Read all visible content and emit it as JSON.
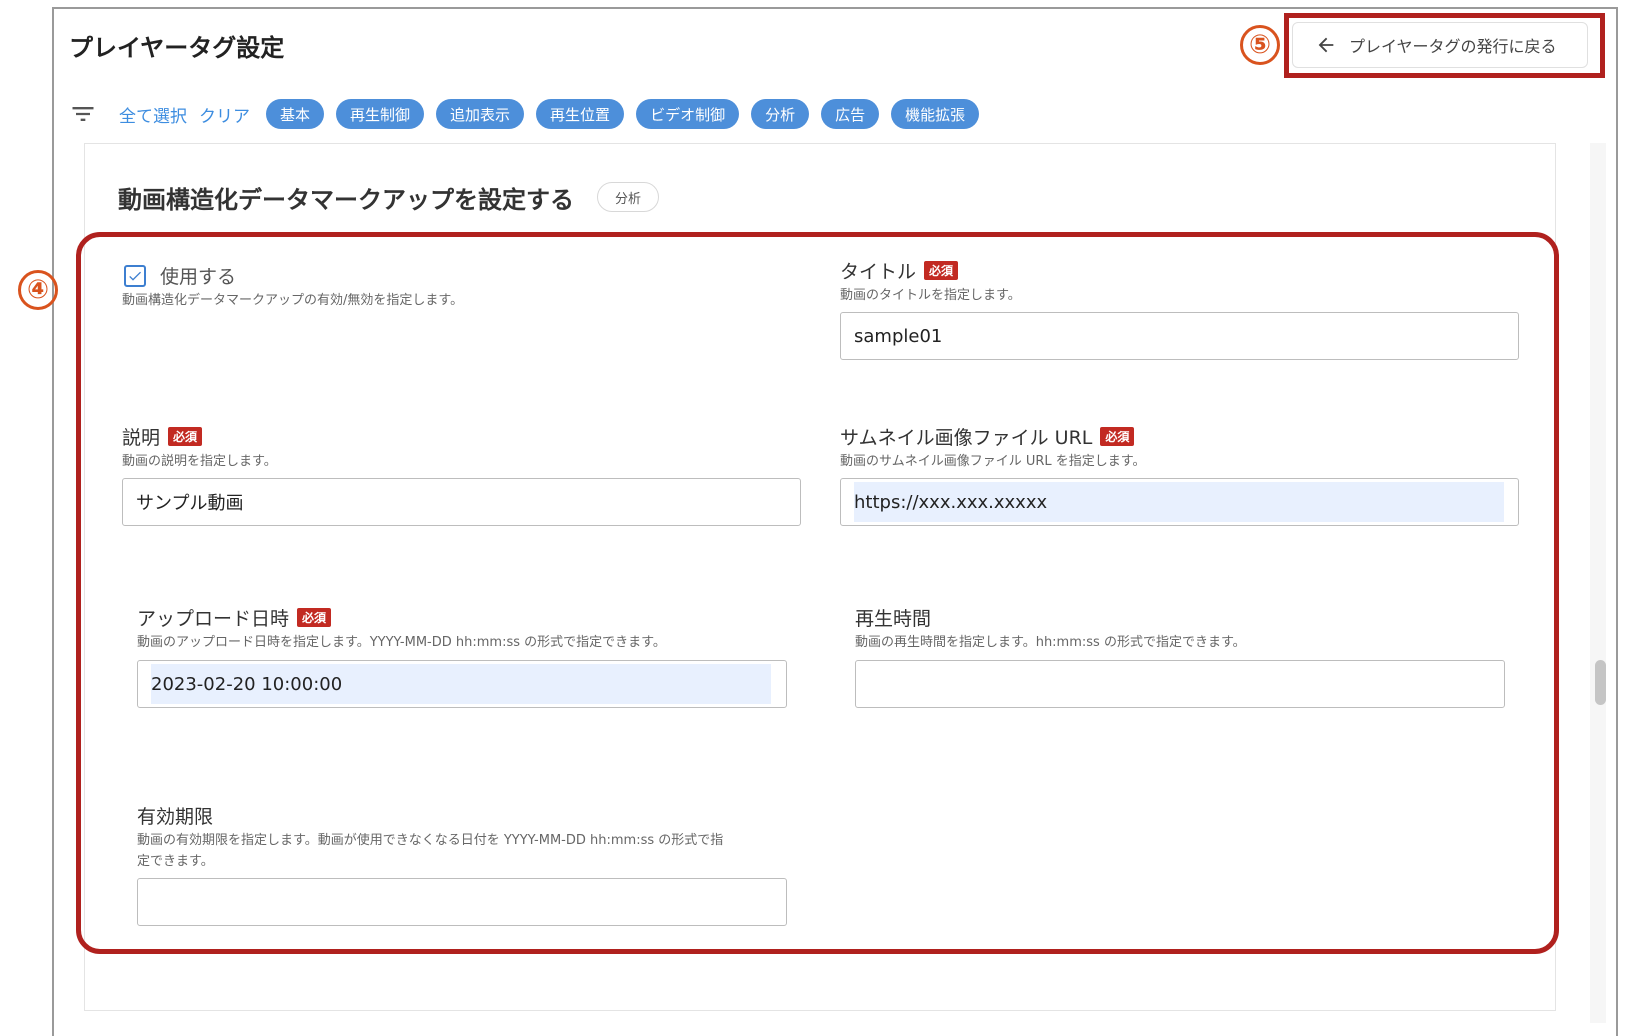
{
  "header": {
    "title": "プレイヤータグ設定",
    "back_button_label": "プレイヤータグの発行に戻る"
  },
  "markers": {
    "back_button": "⑤",
    "form_group": "④"
  },
  "filter_bar": {
    "select_all": "全て選択",
    "clear": "クリア",
    "chips": [
      "基本",
      "再生制御",
      "追加表示",
      "再生位置",
      "ビデオ制御",
      "分析",
      "広告",
      "機能拡張"
    ]
  },
  "section": {
    "title": "動画構造化データマークアップを設定する",
    "badge": "分析",
    "required_badge": "必須",
    "enable": {
      "label": "使用する",
      "checked": true,
      "help": "動画構造化データマークアップの有効/無効を指定します。"
    },
    "title_field": {
      "label": "タイトル",
      "help": "動画のタイトルを指定します。",
      "value": "sample01"
    },
    "description_field": {
      "label": "説明",
      "help": "動画の説明を指定します。",
      "value": "サンプル動画"
    },
    "thumbnail_field": {
      "label": "サムネイル画像ファイル URL",
      "help": "動画のサムネイル画像ファイル URL を指定します。",
      "value": "https://xxx.xxx.xxxxx"
    },
    "upload_date_field": {
      "label": "アップロード日時",
      "help": "動画のアップロード日時を指定します。YYYY-MM-DD hh:mm:ss の形式で指定できます。",
      "value": "2023-02-20 10:00:00"
    },
    "duration_field": {
      "label": "再生時間",
      "help": "動画の再生時間を指定します。hh:mm:ss の形式で指定できます。",
      "value": ""
    },
    "expiry_field": {
      "label": "有効期限",
      "help_line1": "動画の有効期限を指定します。動画が使用できなくなる日付を YYYY-MM-DD hh:mm:ss の形式で指",
      "help_line2": "定できます。",
      "value": ""
    }
  },
  "colors": {
    "accent": "#4d8fda",
    "link": "#3d8de0",
    "required": "#c22a22",
    "highlight_frame": "#b0211e",
    "marker": "#d9531e",
    "autofill": "#e8f0fe"
  }
}
